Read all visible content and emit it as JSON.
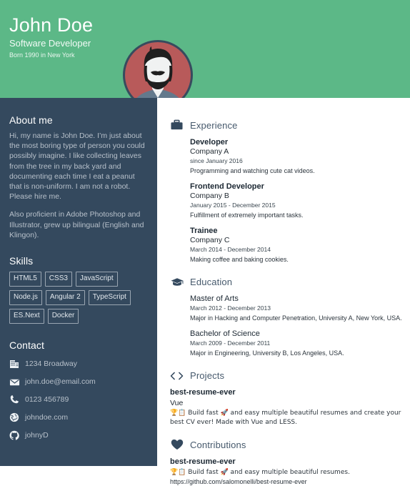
{
  "colors": {
    "header_green": "#5cb887",
    "sidebar_navy": "#34495e",
    "avatar_red": "#b85a5a",
    "heading_blue": "#46596c",
    "body_text": "#2b343c"
  },
  "header": {
    "name": "John Doe",
    "job_title": "Software Developer",
    "born": "Born 1990 in New York",
    "avatar_alt": "avatar"
  },
  "sidebar": {
    "about": {
      "heading": "About me",
      "paragraphs": [
        "Hi, my name is John Doe. I’m just about the most boring type of person you could possibly imagine. I like collecting leaves from the tree in my back yard and documenting each time I eat a peanut that is non-uniform. I am not a robot. Please hire me.",
        "Also proficient in Adobe Photoshop and Illustrator, grew up bilingual (English and Klingon)."
      ]
    },
    "skills": {
      "heading": "Skills",
      "tags": [
        "HTML5",
        "CSS3",
        "JavaScript",
        "Node.js",
        "Angular 2",
        "TypeScript",
        "ES.Next",
        "Docker"
      ]
    },
    "contact": {
      "heading": "Contact",
      "items": [
        {
          "icon": "building-icon",
          "text": "1234 Broadway"
        },
        {
          "icon": "envelope-icon",
          "text": "john.doe@email.com"
        },
        {
          "icon": "phone-icon",
          "text": "0123 456789"
        },
        {
          "icon": "globe-icon",
          "text": "johndoe.com"
        },
        {
          "icon": "github-icon",
          "text": "johnyD"
        }
      ]
    }
  },
  "main": {
    "experience": {
      "icon": "briefcase-icon",
      "title": "Experience",
      "entries": [
        {
          "role": "Developer",
          "company": "Company A",
          "date": "since January 2016",
          "description": "Programming and watching cute cat videos."
        },
        {
          "role": "Frontend Developer",
          "company": "Company B",
          "date": "January 2015 - December 2015",
          "description": "Fulfillment of extremely important tasks."
        },
        {
          "role": "Trainee",
          "company": "Company C",
          "date": "March 2014 - December 2014",
          "description": "Making coffee and baking cookies."
        }
      ]
    },
    "education": {
      "icon": "graduation-cap-icon",
      "title": "Education",
      "entries": [
        {
          "degree": "Master of Arts",
          "date": "March 2012 - December 2013",
          "description": "Major in Hacking and Computer Penetration, University A, New York, USA."
        },
        {
          "degree": "Bachelor of Science",
          "date": "March 2009 - December 2011",
          "description": "Major in Engineering, University B, Los Angeles, USA."
        }
      ]
    },
    "projects": {
      "icon": "code-brackets-icon",
      "title": "Projects",
      "entries": [
        {
          "name": "best-resume-ever",
          "language": "Vue",
          "description": "🏆📋 Build fast 🚀 and easy multiple beautiful resumes and create your best CV ever! Made with Vue and LESS."
        }
      ]
    },
    "contributions": {
      "icon": "heart-icon",
      "title": "Contributions",
      "entries": [
        {
          "name": "best-resume-ever",
          "description": "🏆📋 Build fast 🚀 and easy multiple beautiful resumes.",
          "url": "https://github.com/salomonelli/best-resume-ever"
        }
      ]
    }
  }
}
